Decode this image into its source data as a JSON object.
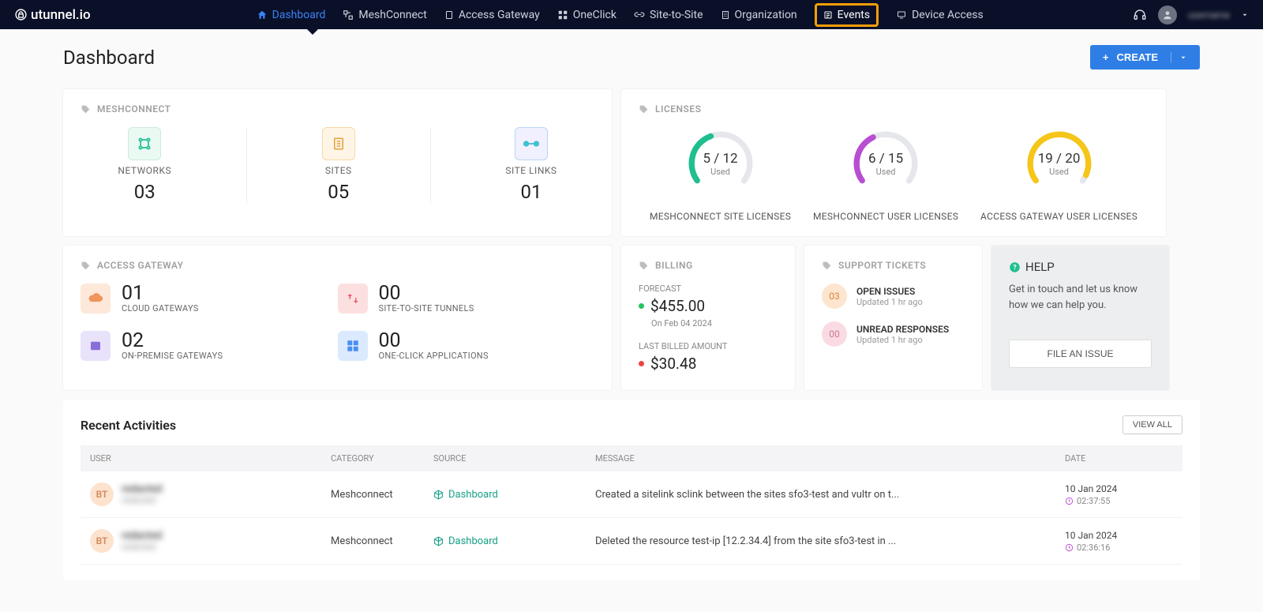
{
  "brand": "utunnel.io",
  "nav": {
    "dashboard": "Dashboard",
    "meshconnect": "MeshConnect",
    "access_gateway": "Access Gateway",
    "oneclick": "OneClick",
    "site_to_site": "Site-to-Site",
    "organization": "Organization",
    "events": "Events",
    "device_access": "Device Access",
    "username": "username"
  },
  "page_title": "Dashboard",
  "create_label": "CREATE",
  "meshconnect": {
    "title": "MESHCONNECT",
    "networks_label": "NETWORKS",
    "networks_count": "03",
    "sites_label": "SITES",
    "sites_count": "05",
    "sitelinks_label": "SITE LINKS",
    "sitelinks_count": "01"
  },
  "licenses": {
    "title": "LICENSES",
    "mc_site": {
      "val": "5 / 12",
      "sub": "Used",
      "label": "MESHCONNECT SITE LICENSES",
      "pct": 42,
      "color": "#1fbf8f"
    },
    "mc_user": {
      "val": "6 / 15",
      "sub": "Used",
      "label": "MESHCONNECT USER LICENSES",
      "pct": 40,
      "color": "#b84ed1"
    },
    "ag_user": {
      "val": "19 / 20",
      "sub": "Used",
      "label": "ACCESS GATEWAY USER LICENSES",
      "pct": 95,
      "color": "#f5c518"
    }
  },
  "access_gateway": {
    "title": "ACCESS GATEWAY",
    "cloud": {
      "num": "01",
      "label": "CLOUD GATEWAYS"
    },
    "s2s": {
      "num": "00",
      "label": "SITE-TO-SITE TUNNELS"
    },
    "onprem": {
      "num": "02",
      "label": "ON-PREMISE GATEWAYS"
    },
    "oneclick": {
      "num": "00",
      "label": "ONE-CLICK APPLICATIONS"
    }
  },
  "billing": {
    "title": "BILLING",
    "forecast_label": "FORECAST",
    "forecast_amount": "$455.00",
    "forecast_date": "On Feb 04 2024",
    "last_label": "LAST BILLED AMOUNT",
    "last_amount": "$30.48"
  },
  "tickets": {
    "title": "SUPPORT TICKETS",
    "open": {
      "badge": "03",
      "title": "OPEN ISSUES",
      "sub": "Updated 1 hr ago"
    },
    "unread": {
      "badge": "00",
      "title": "UNREAD RESPONSES",
      "sub": "Updated 1 hr ago"
    }
  },
  "help": {
    "title": "HELP",
    "text": "Get in touch and let us know how we can help you.",
    "button": "FILE AN ISSUE"
  },
  "recent": {
    "title": "Recent Activities",
    "viewall": "VIEW ALL",
    "columns": {
      "user": "USER",
      "category": "CATEGORY",
      "source": "SOURCE",
      "message": "MESSAGE",
      "date": "DATE"
    },
    "rows": [
      {
        "initials": "BT",
        "name": "redacted",
        "email": "redacted",
        "category": "Meshconnect",
        "source": "Dashboard",
        "message": "Created a sitelink sclink between the sites sfo3-test and vultr on t...",
        "date": "10 Jan 2024",
        "time": "02:37:55"
      },
      {
        "initials": "BT",
        "name": "redacted",
        "email": "redacted",
        "category": "Meshconnect",
        "source": "Dashboard",
        "message": "Deleted the resource test-ip [12.2.34.4] from the site sfo3-test in ...",
        "date": "10 Jan 2024",
        "time": "02:36:16"
      }
    ]
  }
}
